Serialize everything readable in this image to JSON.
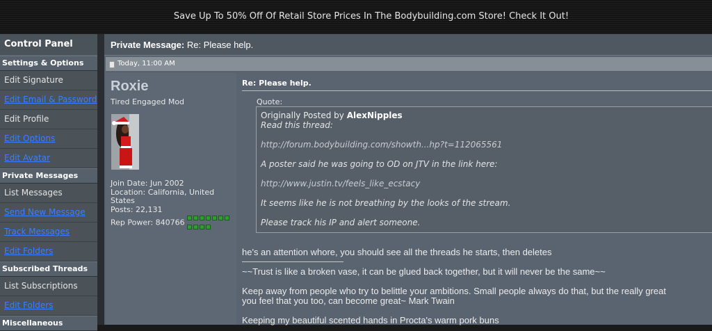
{
  "promo": "Save Up To 50% Off Of Retail Store Prices In The Bodybuilding.com Store! Check It Out!",
  "sidebar": {
    "title": "Control Panel",
    "sections": [
      {
        "heading": "Settings & Options",
        "items": [
          {
            "label": "Edit Signature",
            "link": false
          },
          {
            "label": "Edit Email & Password",
            "link": true
          },
          {
            "label": "Edit Profile",
            "link": false
          },
          {
            "label": "Edit Options",
            "link": true
          },
          {
            "label": "Edit Avatar",
            "link": true
          }
        ]
      },
      {
        "heading": "Private Messages",
        "items": [
          {
            "label": "List Messages",
            "link": false
          },
          {
            "label": "Send New Message",
            "link": true
          },
          {
            "label": "Track Messages",
            "link": true
          },
          {
            "label": "Edit Folders",
            "link": true
          }
        ]
      },
      {
        "heading": "Subscribed Threads",
        "items": [
          {
            "label": "List Subscriptions",
            "link": false
          },
          {
            "label": "Edit Folders",
            "link": true
          }
        ]
      },
      {
        "heading": "Miscellaneous",
        "items": []
      }
    ]
  },
  "pm": {
    "header_label": "Private Message",
    "header_subject": "Re: Please help.",
    "date": "Today, 11:00 AM"
  },
  "user": {
    "name": "Roxie",
    "title": "Tired Engaged Mod",
    "join_date": "Join Date: Jun 2002",
    "location": "Location: California, United States",
    "posts": "Posts: 22,131",
    "rep_power": "Rep Power: 840766"
  },
  "message": {
    "title": "Re: Please help.",
    "quote_label": "Quote:",
    "quote_prefix": "Originally Posted by",
    "quote_author": "AlexNipples",
    "quote_lines": [
      "Read this thread:",
      "http://forum.bodybuilding.com/showth...hp?t=112065561",
      "A poster said he was going to OD on JTV in the link here:",
      "http://www.justin.tv/feels_like_ecstacy",
      "It seems like he is not breathing by the looks of the stream.",
      "Please track his IP and alert someone."
    ],
    "reply": "he's an attention whore, you should see all the threads he starts, then deletes",
    "sig_line1": "~~Trust is like a broken vase, it can be glued back together, but it will never be the same~~",
    "sig_line2": "Keep away from people who try to belittle your ambitions. Small people always do that, but the really great",
    "sig_line3": "you feel that you too, can become great~ Mark Twain",
    "sig_line4": "Keeping my beautiful scented hands in Procta's warm pork buns"
  }
}
